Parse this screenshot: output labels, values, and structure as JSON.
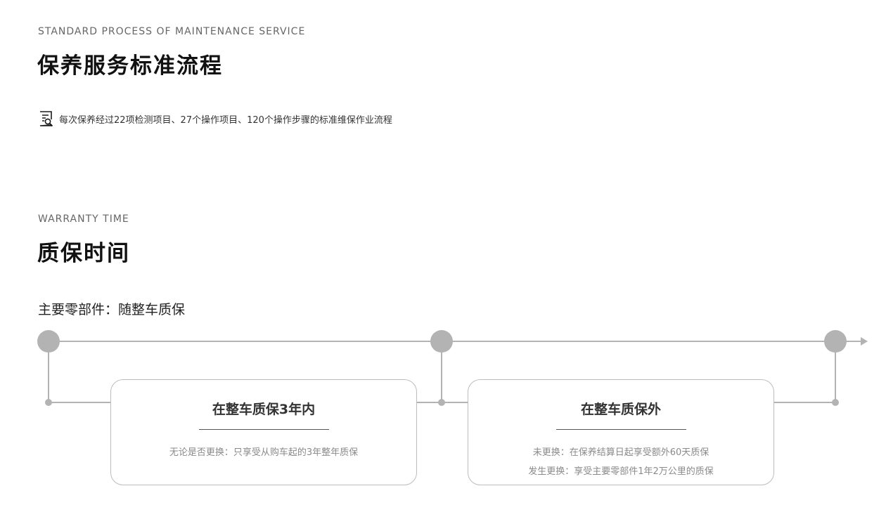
{
  "process_section": {
    "eyebrow": "STANDARD PROCESS OF MAINTENANCE SERVICE",
    "title": "保养服务标准流程",
    "description_icon": "checklist-search-icon",
    "description": "每次保养经过22项检测项目、27个操作项目、120个操作步骤的标准维保作业流程"
  },
  "warranty_section": {
    "eyebrow": "WARRANTY TIME",
    "title": "质保时间",
    "parts_note": "主要零部件：随整车质保",
    "cards": [
      {
        "title": "在整车质保3年内",
        "lines": [
          "无论是否更换：只享受从购车起的3年整年质保"
        ]
      },
      {
        "title": "在整车质保外",
        "lines": [
          "未更换：在保养结算日起享受额外60天质保",
          "发生更换：享受主要零部件1年2万公里的质保"
        ]
      }
    ]
  },
  "colors": {
    "timeline_gray": "#b3b3b3",
    "card_border": "#bdbdbd",
    "heading": "#111111",
    "muted_text": "#8a8a8a"
  }
}
